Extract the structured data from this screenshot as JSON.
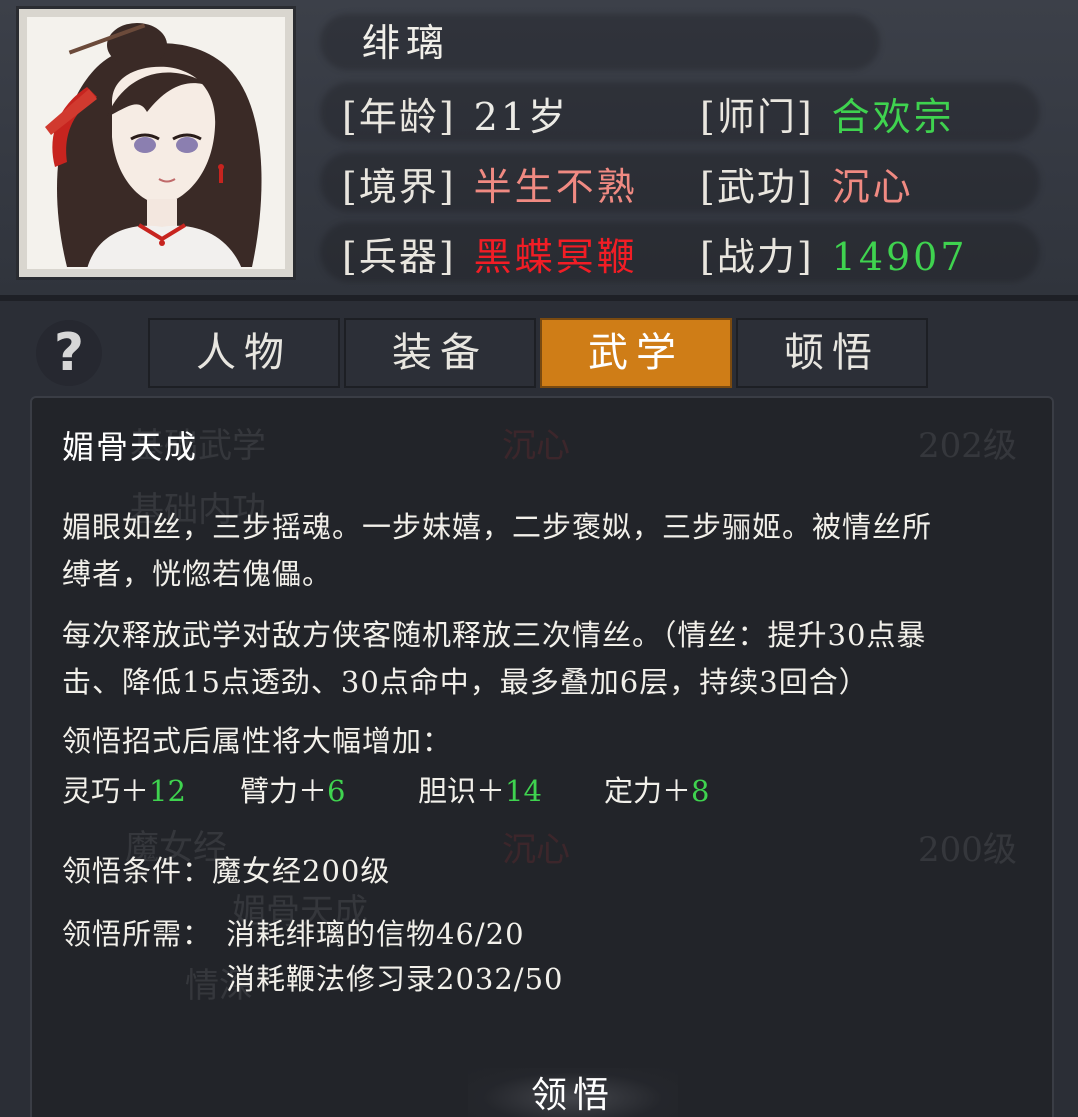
{
  "character": {
    "name": "绯璃",
    "age": {
      "label": "[年龄]",
      "value": "21岁"
    },
    "sect": {
      "label": "[师门]",
      "value": "合欢宗",
      "color": "#3fd34f"
    },
    "realm": {
      "label": "[境界]",
      "value": "半生不熟",
      "color": "#f08a82"
    },
    "martial": {
      "label": "[武功]",
      "value": "沉心",
      "color": "#f08a82"
    },
    "weapon": {
      "label": "[兵器]",
      "value": "黑蝶冥鞭",
      "color": "#f21d25"
    },
    "power": {
      "label": "[战力]",
      "value": "14907",
      "color": "#3fd34f"
    }
  },
  "help": {
    "icon": "question-icon",
    "glyph": "?"
  },
  "tabs": [
    {
      "label": "人物",
      "active": false
    },
    {
      "label": "装备",
      "active": false
    },
    {
      "label": "武学",
      "active": true
    },
    {
      "label": "顿悟",
      "active": false
    }
  ],
  "background_list": {
    "row1": {
      "name": "基础武学",
      "type": "沉心",
      "level": "202级"
    },
    "row2": {
      "name": "基础内功"
    },
    "row3": {
      "name": "魔女经",
      "type": "沉心",
      "level": "200级"
    },
    "row4": {
      "name": "媚骨天成"
    },
    "row5": {
      "name": "情深"
    }
  },
  "skill": {
    "title": "媚骨天成",
    "desc_line1": "媚眼如丝，三步摇魂。一步妹嬉，二步褒姒，三步骊姬。被情丝所",
    "desc_line2": "缚者，恍惚若傀儡。",
    "effect_line1": "每次释放武学对敌方侠客随机释放三次情丝。（情丝：提升30点暴",
    "effect_line2": "击、降低15点透劲、30点命中，最多叠加6层，持续3回合）",
    "bonus_header": "领悟招式后属性将大幅增加：",
    "bonuses": [
      {
        "name": "灵巧＋",
        "value": "12"
      },
      {
        "name": "臂力＋",
        "value": "6"
      },
      {
        "name": "胆识＋",
        "value": "14"
      },
      {
        "name": "定力＋",
        "value": "8"
      }
    ],
    "condition": "领悟条件：魔女经200级",
    "requirement_label": "领悟所需：",
    "requirement_1": "消耗绯璃的信物46/20",
    "requirement_2": "消耗鞭法修习录2032/50"
  },
  "learn_button": "领悟",
  "colors": {
    "accent": "#cf7d17",
    "green": "#3fd34f",
    "red": "#f21d25",
    "salmon": "#f08a82"
  }
}
